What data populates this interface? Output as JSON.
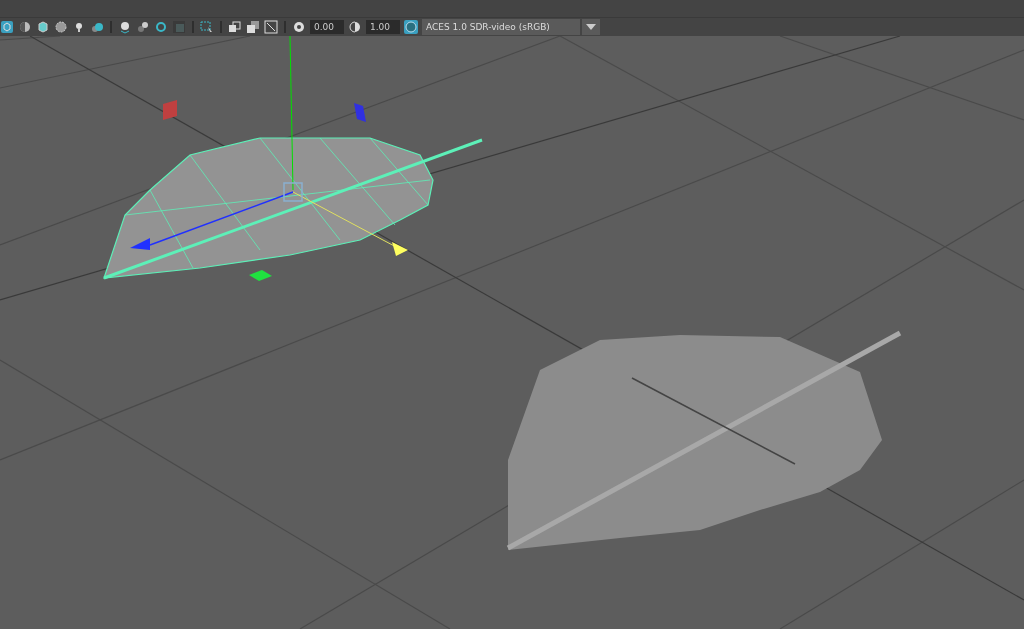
{
  "toolbar": {
    "exposure": {
      "value": "0.00"
    },
    "gamma": {
      "value": "1.00"
    },
    "color_space": {
      "label": "ACES 1.0 SDR-video (sRGB)"
    }
  }
}
